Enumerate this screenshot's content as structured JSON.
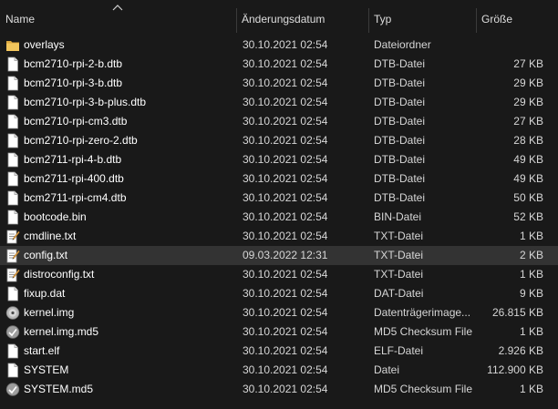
{
  "columns": {
    "name": "Name",
    "date": "Änderungsdatum",
    "type": "Typ",
    "size": "Größe"
  },
  "colors": {
    "background": "#191919",
    "selected_row": "#333333",
    "folder_icon": "#e8b64a",
    "text": "#ffffff",
    "secondary_text": "#d6d6d6"
  },
  "files": [
    {
      "name": "overlays",
      "date": "30.10.2021 02:54",
      "type": "Dateiordner",
      "size": "",
      "icon": "folder-icon"
    },
    {
      "name": "bcm2710-rpi-2-b.dtb",
      "date": "30.10.2021 02:54",
      "type": "DTB-Datei",
      "size": "27 KB",
      "icon": "file-icon"
    },
    {
      "name": "bcm2710-rpi-3-b.dtb",
      "date": "30.10.2021 02:54",
      "type": "DTB-Datei",
      "size": "29 KB",
      "icon": "file-icon"
    },
    {
      "name": "bcm2710-rpi-3-b-plus.dtb",
      "date": "30.10.2021 02:54",
      "type": "DTB-Datei",
      "size": "29 KB",
      "icon": "file-icon"
    },
    {
      "name": "bcm2710-rpi-cm3.dtb",
      "date": "30.10.2021 02:54",
      "type": "DTB-Datei",
      "size": "27 KB",
      "icon": "file-icon"
    },
    {
      "name": "bcm2710-rpi-zero-2.dtb",
      "date": "30.10.2021 02:54",
      "type": "DTB-Datei",
      "size": "28 KB",
      "icon": "file-icon"
    },
    {
      "name": "bcm2711-rpi-4-b.dtb",
      "date": "30.10.2021 02:54",
      "type": "DTB-Datei",
      "size": "49 KB",
      "icon": "file-icon"
    },
    {
      "name": "bcm2711-rpi-400.dtb",
      "date": "30.10.2021 02:54",
      "type": "DTB-Datei",
      "size": "49 KB",
      "icon": "file-icon"
    },
    {
      "name": "bcm2711-rpi-cm4.dtb",
      "date": "30.10.2021 02:54",
      "type": "DTB-Datei",
      "size": "50 KB",
      "icon": "file-icon"
    },
    {
      "name": "bootcode.bin",
      "date": "30.10.2021 02:54",
      "type": "BIN-Datei",
      "size": "52 KB",
      "icon": "file-icon"
    },
    {
      "name": "cmdline.txt",
      "date": "30.10.2021 02:54",
      "type": "TXT-Datei",
      "size": "1 KB",
      "icon": "text-file-icon"
    },
    {
      "name": "config.txt",
      "date": "09.03.2022 12:31",
      "type": "TXT-Datei",
      "size": "2 KB",
      "icon": "text-file-icon",
      "selected": true
    },
    {
      "name": "distroconfig.txt",
      "date": "30.10.2021 02:54",
      "type": "TXT-Datei",
      "size": "1 KB",
      "icon": "text-file-icon"
    },
    {
      "name": "fixup.dat",
      "date": "30.10.2021 02:54",
      "type": "DAT-Datei",
      "size": "9 KB",
      "icon": "file-icon"
    },
    {
      "name": "kernel.img",
      "date": "30.10.2021 02:54",
      "type": "Datenträgerimage...",
      "size": "26.815 KB",
      "icon": "disc-image-icon"
    },
    {
      "name": "kernel.img.md5",
      "date": "30.10.2021 02:54",
      "type": "MD5 Checksum File",
      "size": "1 KB",
      "icon": "checksum-file-icon"
    },
    {
      "name": "start.elf",
      "date": "30.10.2021 02:54",
      "type": "ELF-Datei",
      "size": "2.926 KB",
      "icon": "file-icon"
    },
    {
      "name": "SYSTEM",
      "date": "30.10.2021 02:54",
      "type": "Datei",
      "size": "112.900 KB",
      "icon": "file-icon"
    },
    {
      "name": "SYSTEM.md5",
      "date": "30.10.2021 02:54",
      "type": "MD5 Checksum File",
      "size": "1 KB",
      "icon": "checksum-file-icon"
    }
  ]
}
